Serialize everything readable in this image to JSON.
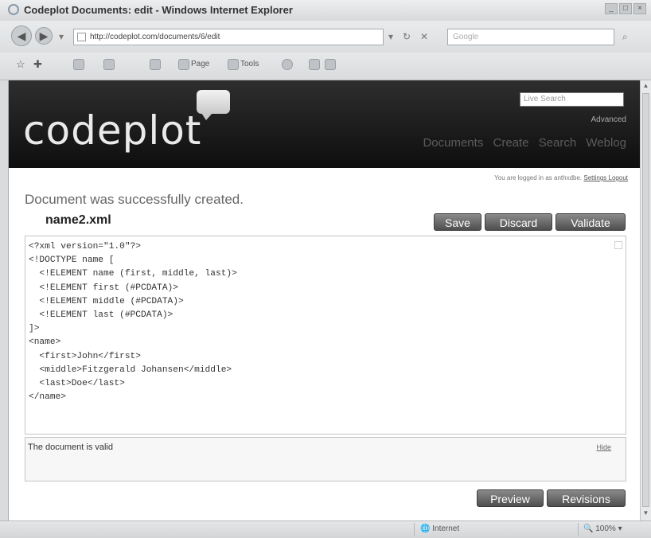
{
  "window": {
    "title": "Codeplot Documents: edit - Windows Internet Explorer",
    "controls": [
      "_",
      "□",
      "×"
    ]
  },
  "browser": {
    "address": "http://codeplot.com/documents/6/edit",
    "search_placeholder": "Google",
    "toolbar": {
      "page": "Page",
      "tools": "Tools"
    },
    "status_zone": "Internet",
    "zoom": "100%"
  },
  "site": {
    "logo": "codeplot",
    "search_placeholder": "Live Search",
    "advanced": "Advanced",
    "nav": [
      "Documents",
      "Create",
      "Search",
      "Weblog"
    ],
    "login_note": "You are logged in as anthxdbe.",
    "logout_label": "Settings Logout"
  },
  "page": {
    "flash": "Document was successfully created.",
    "doc_name": "name2.xml",
    "buttons": {
      "save": "Save",
      "discard": "Discard",
      "validate": "Validate",
      "preview": "Preview",
      "revisions": "Revisions"
    },
    "code_lines": [
      "<?xml version=\"1.0\"?>",
      "<!DOCTYPE name [",
      "  <!ELEMENT name (first, middle, last)>",
      "  <!ELEMENT first (#PCDATA)>",
      "  <!ELEMENT middle (#PCDATA)>",
      "  <!ELEMENT last (#PCDATA)>",
      "]>",
      "<name>",
      "  <first>John</first>",
      "  <middle>Fitzgerald Johansen</middle>",
      "  <last>Doe</last>",
      "</name>"
    ],
    "status_message": "The document is valid",
    "hide_label": "Hide"
  }
}
